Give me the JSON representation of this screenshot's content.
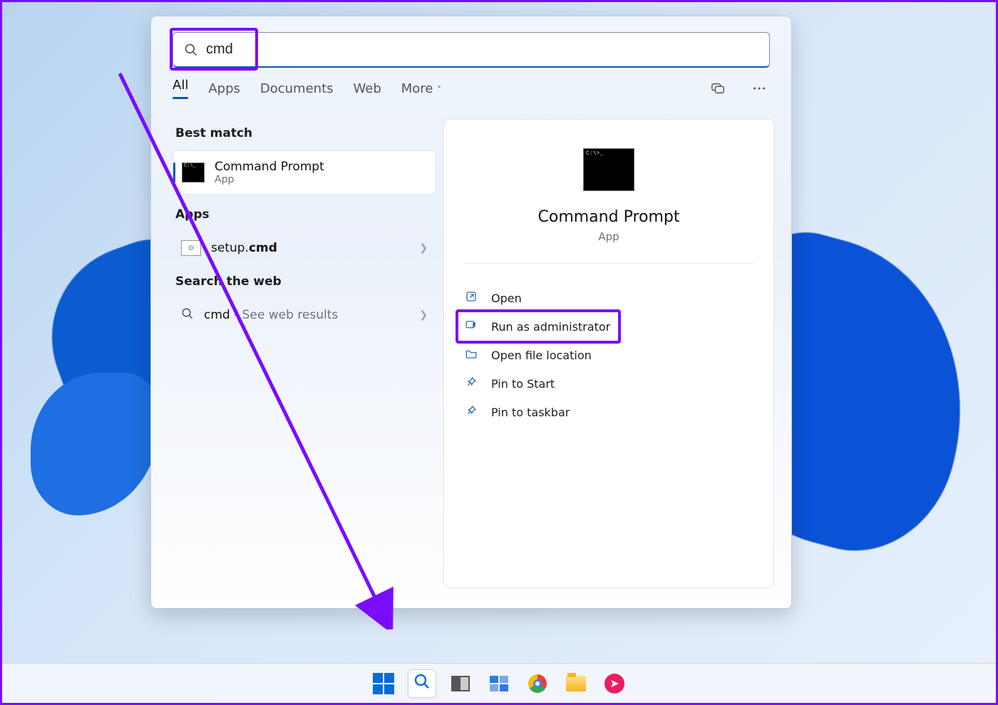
{
  "search": {
    "value": "cmd",
    "tabs": [
      "All",
      "Apps",
      "Documents",
      "Web",
      "More"
    ],
    "active_tab": "All"
  },
  "sections": {
    "best_match": "Best match",
    "apps": "Apps",
    "web": "Search the web"
  },
  "results": {
    "best": {
      "title": "Command Prompt",
      "sub": "App"
    },
    "app": {
      "title_prefix": "setup.",
      "title_bold": "cmd"
    },
    "web": {
      "term": "cmd",
      "suffix": " - See web results"
    }
  },
  "preview": {
    "title": "Command Prompt",
    "sub": "App",
    "actions": [
      {
        "icon": "open",
        "label": "Open"
      },
      {
        "icon": "admin",
        "label": "Run as administrator"
      },
      {
        "icon": "folder",
        "label": "Open file location"
      },
      {
        "icon": "pin-start",
        "label": "Pin to Start"
      },
      {
        "icon": "pin-taskbar",
        "label": "Pin to taskbar"
      }
    ]
  },
  "taskbar": [
    "start",
    "search",
    "taskview",
    "widgets",
    "chrome",
    "explorer",
    "app"
  ]
}
